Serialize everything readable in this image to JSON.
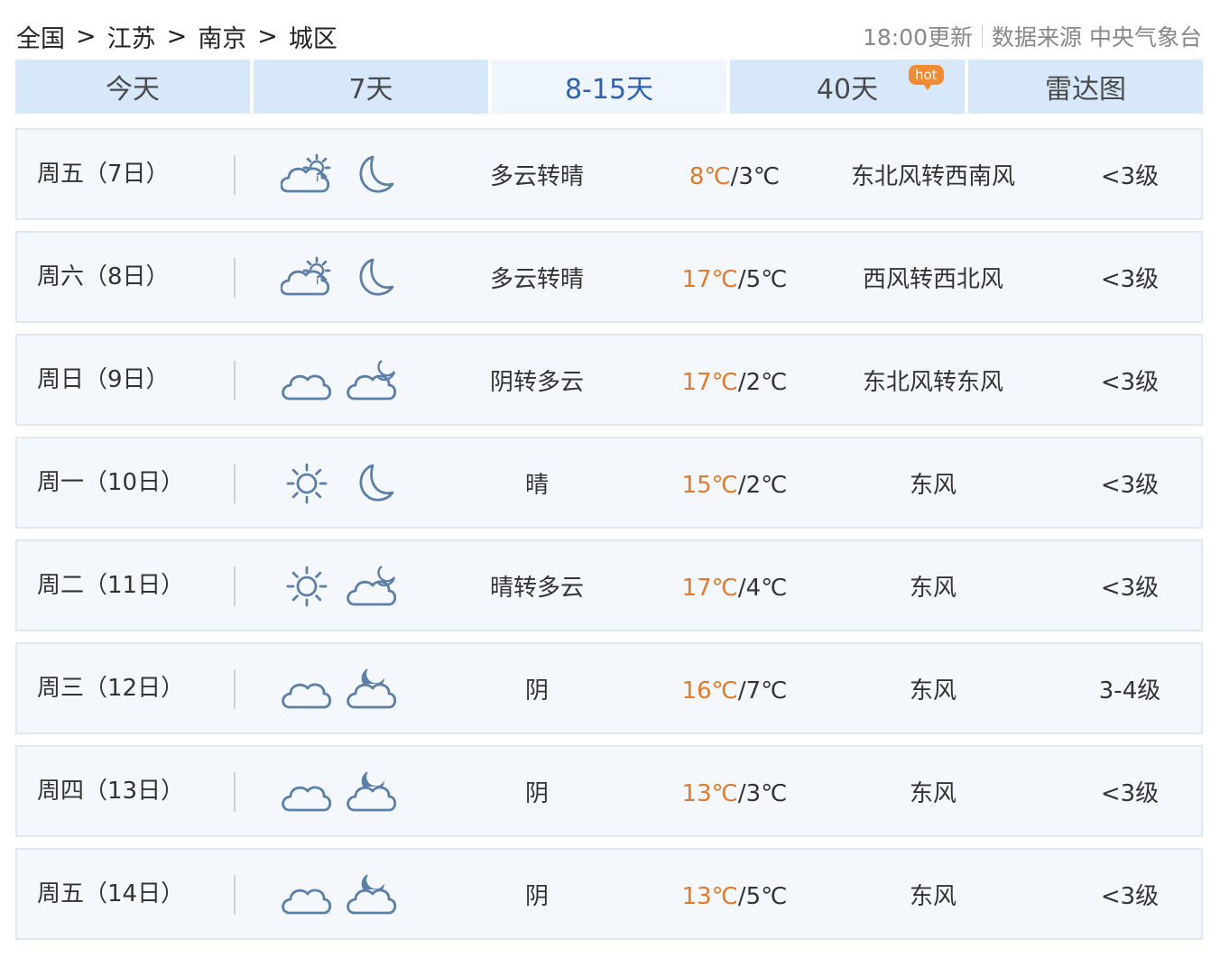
{
  "breadcrumb": [
    "全国",
    "江苏",
    "南京",
    "城区"
  ],
  "breadcrumb_sep": ">",
  "meta": {
    "updated": "18:00更新",
    "source": "数据来源 中央气象台"
  },
  "tabs": [
    {
      "label": "今天",
      "active": false
    },
    {
      "label": "7天",
      "active": false
    },
    {
      "label": "8-15天",
      "active": true
    },
    {
      "label": "40天",
      "active": false,
      "badge": "hot"
    },
    {
      "label": "雷达图",
      "active": false
    }
  ],
  "forecast": [
    {
      "date": "周五（7日）",
      "day_icon": "partly-cloudy-day-icon",
      "night_icon": "moon-icon",
      "desc": "多云转晴",
      "high": "8℃",
      "low": "3℃",
      "wind": "东北风转西南风",
      "level": "<3级"
    },
    {
      "date": "周六（8日）",
      "day_icon": "partly-cloudy-day-icon",
      "night_icon": "moon-icon",
      "desc": "多云转晴",
      "high": "17℃",
      "low": "5℃",
      "wind": "西风转西北风",
      "level": "<3级"
    },
    {
      "date": "周日（9日）",
      "day_icon": "cloud-icon",
      "night_icon": "cloudy-night-icon",
      "desc": "阴转多云",
      "high": "17℃",
      "low": "2℃",
      "wind": "东北风转东风",
      "level": "<3级"
    },
    {
      "date": "周一（10日）",
      "day_icon": "sun-icon",
      "night_icon": "moon-icon",
      "desc": "晴",
      "high": "15℃",
      "low": "2℃",
      "wind": "东风",
      "level": "<3级"
    },
    {
      "date": "周二（11日）",
      "day_icon": "sun-icon",
      "night_icon": "cloudy-night-icon",
      "desc": "晴转多云",
      "high": "17℃",
      "low": "4℃",
      "wind": "东风",
      "level": "<3级"
    },
    {
      "date": "周三（12日）",
      "day_icon": "cloud-icon",
      "night_icon": "overcast-night-icon",
      "desc": "阴",
      "high": "16℃",
      "low": "7℃",
      "wind": "东风",
      "level": "3-4级"
    },
    {
      "date": "周四（13日）",
      "day_icon": "cloud-icon",
      "night_icon": "overcast-night-icon",
      "desc": "阴",
      "high": "13℃",
      "low": "3℃",
      "wind": "东风",
      "level": "<3级"
    },
    {
      "date": "周五（14日）",
      "day_icon": "cloud-icon",
      "night_icon": "overcast-night-icon",
      "desc": "阴",
      "high": "13℃",
      "low": "5℃",
      "wind": "东风",
      "level": "<3级"
    }
  ],
  "colors": {
    "accent": "#2e62b0",
    "high_temp": "#e07a2e",
    "tab_bg": "#d6e8f9",
    "icon_stroke": "#5b7fa6"
  }
}
